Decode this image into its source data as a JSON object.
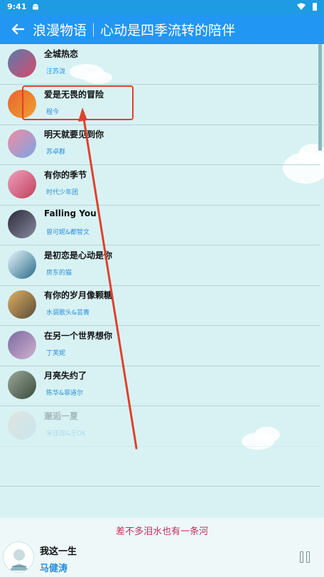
{
  "status_bar": {
    "time": "9:41"
  },
  "app_bar": {
    "title": "浪漫物语｜心动是四季流转的陪伴"
  },
  "songs": [
    {
      "title": "全城热恋",
      "artist": "汪苏泷",
      "colors": [
        "#5a7bb0",
        "#d84a6a"
      ]
    },
    {
      "title": "爱是无畏的冒险",
      "artist": "程今",
      "colors": [
        "#e8642c",
        "#f0a030"
      ]
    },
    {
      "title": "明天就要见到你",
      "artist": "苏卓群",
      "colors": [
        "#f28aa0",
        "#7aa6e6"
      ]
    },
    {
      "title": "有你的季节",
      "artist": "时代少年团",
      "colors": [
        "#f0a0c0",
        "#c0405a"
      ]
    },
    {
      "title": "Falling You",
      "artist": "曾可妮&都智文",
      "colors": [
        "#2a2a3a",
        "#8a8aa0"
      ]
    },
    {
      "title": "是初恋是心动是你",
      "artist": "房东的猫",
      "colors": [
        "#e8f6fa",
        "#2a6a8a"
      ]
    },
    {
      "title": "有你的岁月像颗糖",
      "artist": "水调歌头&芸菁",
      "colors": [
        "#e0b060",
        "#5a4a3a"
      ]
    },
    {
      "title": "在另一个世界想你",
      "artist": "丁芙妮",
      "colors": [
        "#7a6aa0",
        "#d0b0d0"
      ]
    },
    {
      "title": "月亮失约了",
      "artist": "陈华&菲道尔",
      "colors": [
        "#9aa89a",
        "#3a4a3a"
      ]
    },
    {
      "title": "邂逅一夏",
      "artist": "宋佳润&王OK",
      "colors": [
        "#f0c0a0",
        "#a0c0e0"
      ]
    }
  ],
  "player": {
    "lyric": "差不多泪水也有一条河",
    "title": "我这一生",
    "artist": "马健涛"
  }
}
